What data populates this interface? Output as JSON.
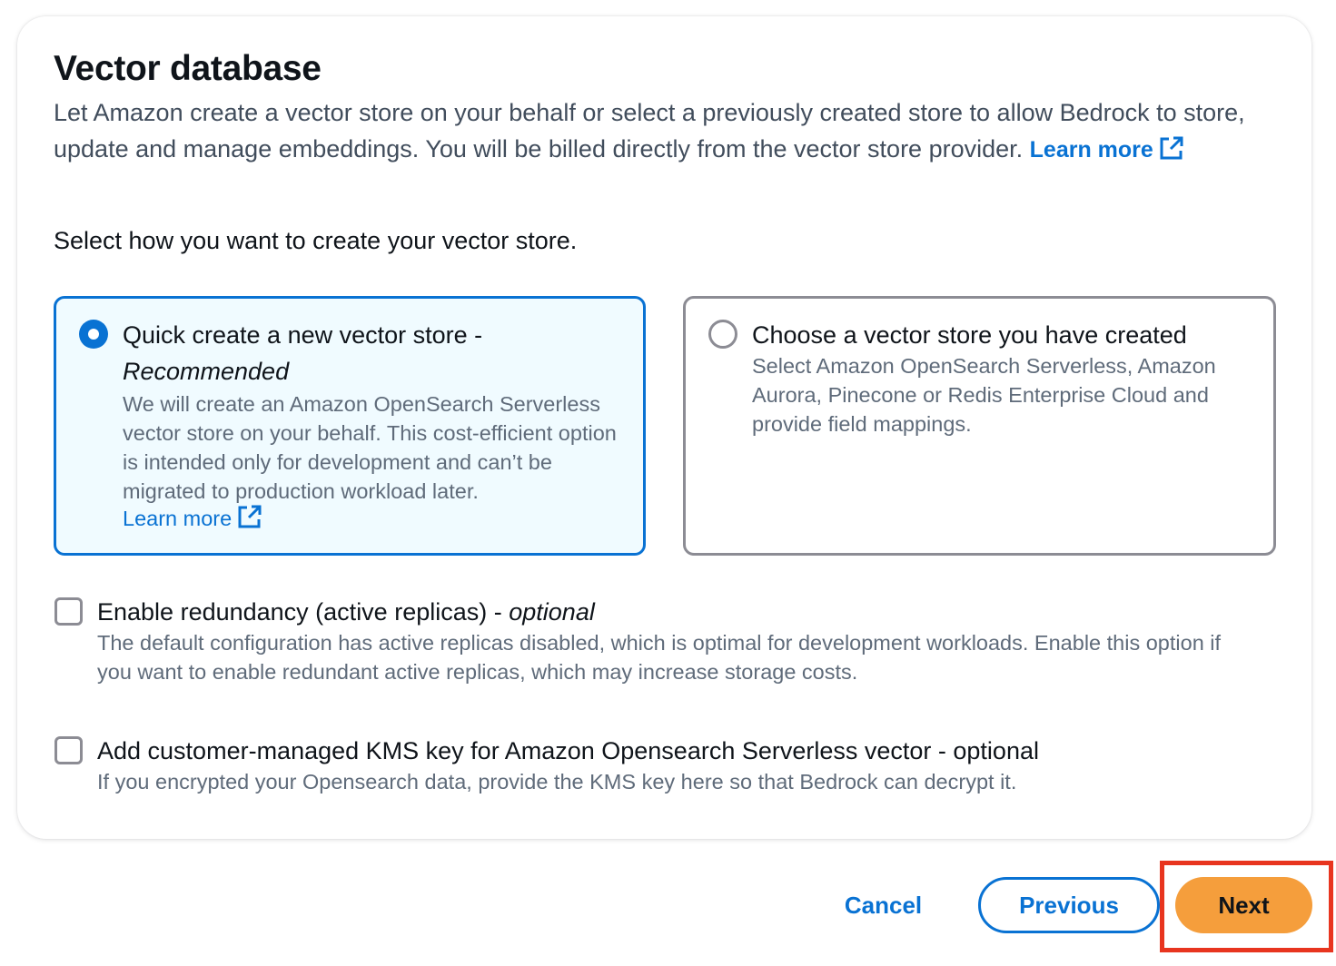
{
  "section": {
    "title": "Vector database",
    "description": "Let Amazon create a vector store on your behalf or select a previously created store to allow Bedrock to store, update and manage embeddings. You will be billed directly from the vector store provider.",
    "learn_more": "Learn more",
    "prompt": "Select how you want to create your vector store."
  },
  "options": [
    {
      "title": "Quick create a new vector store -",
      "title_suffix": "Recommended",
      "description": "We will create an Amazon OpenSearch Serverless vector store on your behalf. This cost-efficient option is intended only for development and can’t be migrated to production workload later.",
      "learn_more": "Learn more",
      "selected": true
    },
    {
      "title": "Choose a vector store you have created",
      "description": "Select Amazon OpenSearch Serverless, Amazon Aurora, Pinecone or Redis Enterprise Cloud and provide field mappings.",
      "selected": false
    }
  ],
  "checkboxes": [
    {
      "label": "Enable redundancy (active replicas) -",
      "label_suffix": "optional",
      "description": "The default configuration has active replicas disabled, which is optimal for development workloads. Enable this option if you want to enable redundant active replicas, which may increase storage costs.",
      "checked": false
    },
    {
      "label": "Add customer-managed KMS key for Amazon Opensearch Serverless vector - optional",
      "description": "If you encrypted your Opensearch data, provide the KMS key here so that Bedrock can decrypt it.",
      "checked": false
    }
  ],
  "footer": {
    "cancel": "Cancel",
    "previous": "Previous",
    "next": "Next"
  },
  "colors": {
    "link": "#0972d3",
    "primary_button": "#f59e3c",
    "highlight_box": "#e8351f",
    "selected_tile_bg": "#f0fbff"
  },
  "icons": {
    "external_link": "external-link-icon",
    "radio_selected": "radio-selected-icon",
    "radio_unselected": "radio-unselected-icon"
  }
}
